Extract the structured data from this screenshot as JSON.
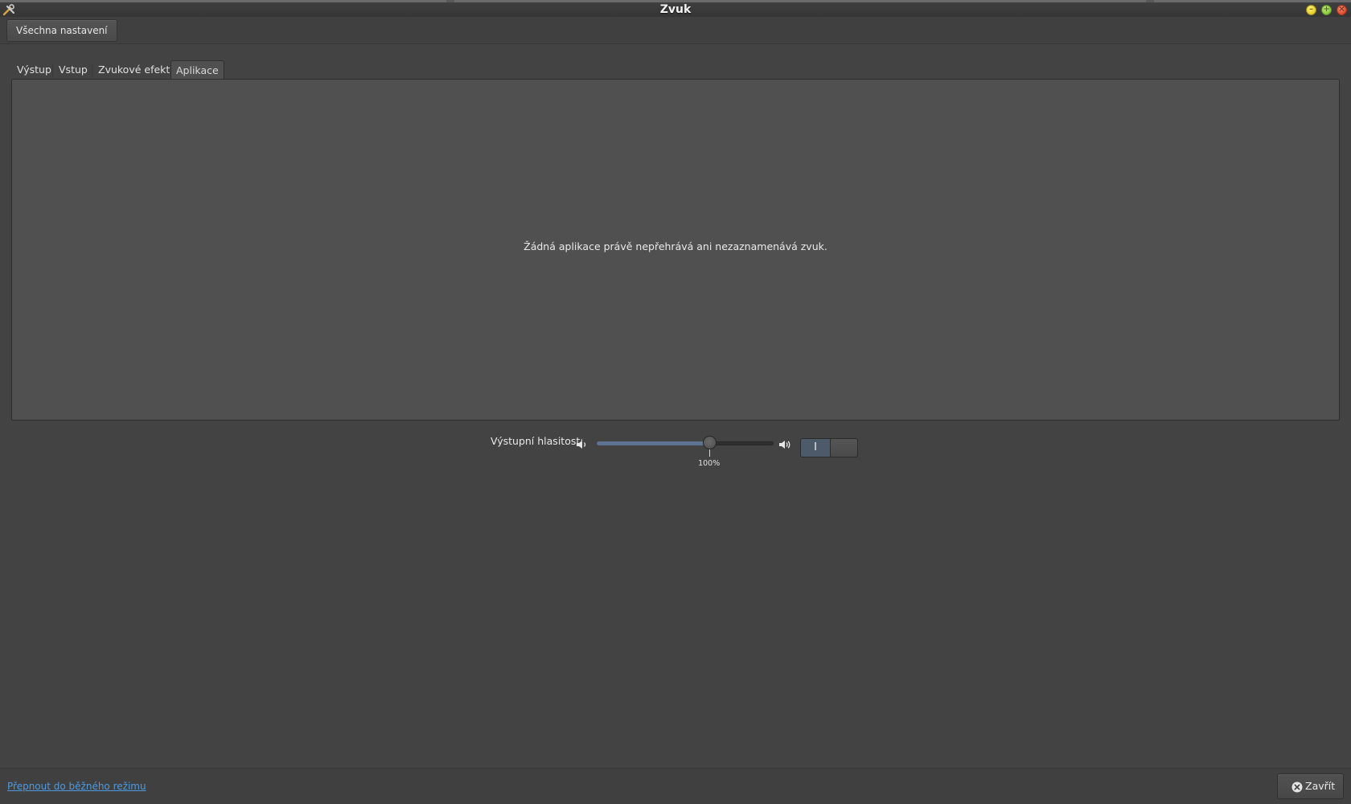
{
  "window": {
    "title": "Zvuk",
    "app_icon": "sound-settings-icon",
    "controls": [
      "minimize-icon",
      "maximize-icon",
      "close-icon"
    ]
  },
  "toolbar": {
    "all_settings_label": "Všechna nastavení"
  },
  "tabs": [
    {
      "label": "Výstup",
      "active": false
    },
    {
      "label": "Vstup",
      "active": false
    },
    {
      "label": "Zvukové efekty",
      "active": false
    },
    {
      "label": "Aplikace",
      "active": true
    }
  ],
  "panel": {
    "empty_message": "Žádná aplikace právě nepřehrává ani nezaznamenává zvuk."
  },
  "volume": {
    "label": "Výstupní hlasitost:",
    "value_fraction": 0.635,
    "mark_label": "100%",
    "mark_fraction": 0.635,
    "mute_toggle_on_glyph": "I",
    "accent_color": "#5d7290"
  },
  "footer": {
    "mode_link": "Přepnout do běžného režimu",
    "close_label": "Zavřít",
    "link_color": "#4f9ae0"
  }
}
